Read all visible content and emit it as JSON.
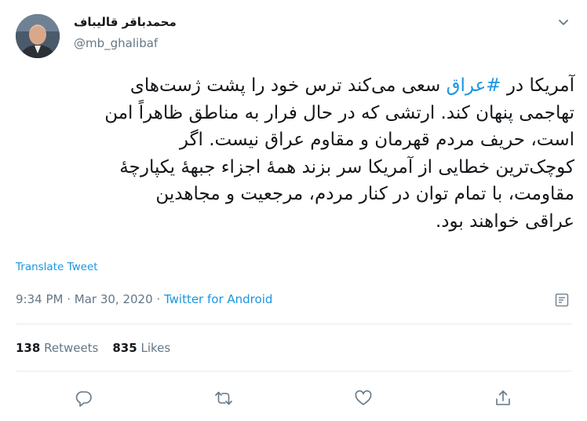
{
  "author": {
    "name": "محمدباقر قالیباف",
    "handle": "@mb_ghalibaf"
  },
  "tweet": {
    "lines": [
      {
        "before": "آمریکا در ",
        "hashtag": "#عراق",
        "after": " سعی می‌کند ترس خود را پشت ژست‌های"
      },
      {
        "text": "تهاجمی پنهان کند. ارتشی که در حال فرار به مناطق ظاهراً امن"
      },
      {
        "text": "است، حریف مردم قهرمان و مقاوم عراق نیست. اگر"
      },
      {
        "text": "کوچک‌ترین خطایی از آمریکا سر بزند همهٔ اجزاء جبههٔ یکپارچهٔ"
      },
      {
        "text": "مقاومت، با تمام توان در کنار مردم، مرجعیت و مجاهدین"
      },
      {
        "text": "عراقی خواهند بود."
      }
    ]
  },
  "translate_label": "Translate Tweet",
  "meta": {
    "time": "9:34 PM",
    "separator": " · ",
    "date": "Mar 30, 2020",
    "source": "Twitter for Android"
  },
  "stats": {
    "retweets_count": "138",
    "retweets_label": "Retweets",
    "likes_count": "835",
    "likes_label": "Likes"
  },
  "icons": {
    "caret": "chevron-down-icon",
    "analytics": "analytics-icon",
    "reply": "reply-icon",
    "retweet": "retweet-icon",
    "like": "heart-icon",
    "share": "share-icon"
  },
  "colors": {
    "link": "#1b95e0",
    "muted": "#657786",
    "text": "#14171a",
    "divider": "#e6ecf0"
  }
}
